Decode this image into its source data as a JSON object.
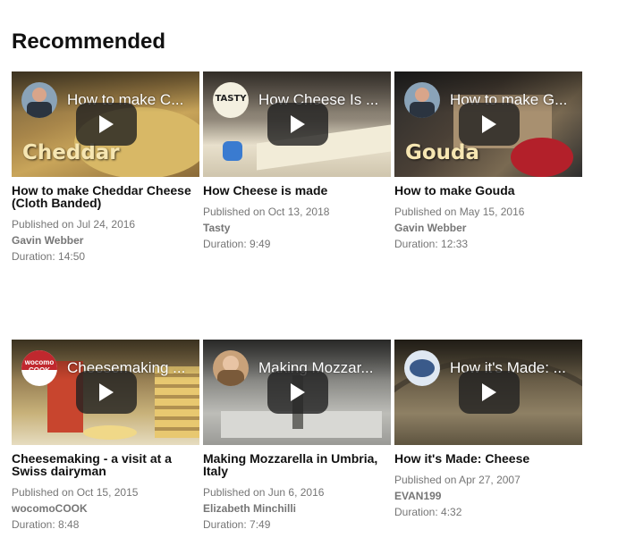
{
  "section": {
    "heading": "Recommended"
  },
  "videos": [
    {
      "overlay_title": "How to make C...",
      "thumbnail_label": "Cheddar",
      "title": "How to make Cheddar Cheese (Cloth Banded)",
      "published": "Published on Jul 24, 2016",
      "channel": "Gavin Webber",
      "duration": "Duration: 14:50"
    },
    {
      "overlay_title": "How Cheese Is ...",
      "avatar_text": "TASTY",
      "title": "How Cheese is made",
      "published": "Published on Oct 13, 2018",
      "channel": "Tasty",
      "duration": "Duration: 9:49"
    },
    {
      "overlay_title": "How to make G...",
      "thumbnail_label": "Gouda",
      "title": "How to make Gouda",
      "published": "Published on May 15, 2016",
      "channel": "Gavin Webber",
      "duration": "Duration: 12:33"
    },
    {
      "overlay_title": "Cheesemaking ...",
      "avatar_text": "wocomo COOK",
      "title": "Cheesemaking - a visit at a Swiss dairyman",
      "published": "Published on Oct 15, 2015",
      "channel": "wocomoCOOK",
      "duration": "Duration: 8:48"
    },
    {
      "overlay_title": "Making Mozzar...",
      "title": "Making Mozzarella in Umbria, Italy",
      "published": "Published on Jun 6, 2016",
      "channel": "Elizabeth Minchilli",
      "duration": "Duration: 7:49"
    },
    {
      "overlay_title": "How it's Made: ...",
      "title": "How it's Made: Cheese",
      "published": "Published on Apr 27, 2007",
      "channel": "EVAN199",
      "duration": "Duration: 4:32"
    }
  ],
  "icons": {
    "play": "play-icon"
  },
  "colors": {
    "play_bg": "#212121",
    "meta_text": "#767676"
  }
}
